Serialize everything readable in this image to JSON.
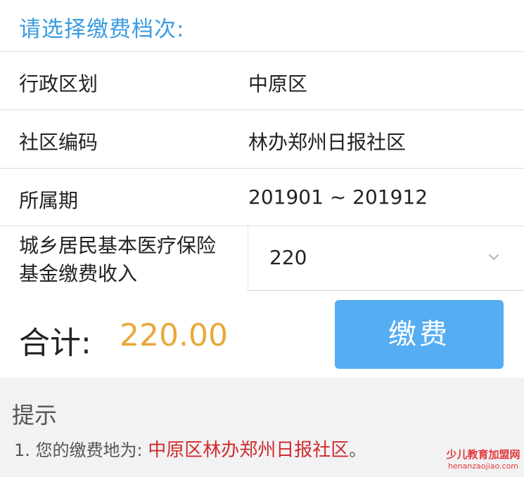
{
  "header": {
    "title": "请选择缴费档次:"
  },
  "form": {
    "district": {
      "label": "行政区划",
      "value": "中原区"
    },
    "community": {
      "label": "社区编码",
      "value": "林办郑州日报社区"
    },
    "period": {
      "label": "所属期",
      "value": "201901 ~ 201912"
    },
    "tier": {
      "label": "城乡居民基本医疗保险基金缴费收入",
      "selected": "220",
      "icon": "chevron-down-icon"
    }
  },
  "total": {
    "label": "合计:",
    "amount": "220.00",
    "pay_label": "缴费"
  },
  "tips": {
    "title": "提示",
    "line_prefix": "1. 您的缴费地为: ",
    "location": "中原区林办郑州日报社区",
    "line_suffix": "。"
  },
  "watermark": {
    "cn": "少儿教育加盟网",
    "en": "henanzaojiao.com"
  },
  "colors": {
    "accent": "#3a9be0",
    "button": "#55adf2",
    "amount": "#e8a93a",
    "highlight": "#cf2b2b"
  }
}
